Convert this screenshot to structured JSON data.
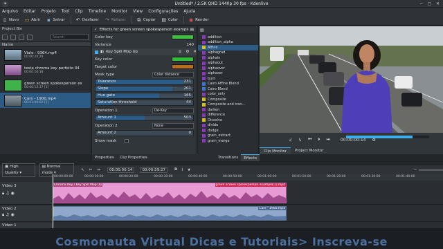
{
  "window": {
    "title": "Untitled* / 2.5K QHD 1440p 30 fps - Kdenlive"
  },
  "menu": [
    "Arquivo",
    "Editar",
    "Projeto",
    "Tool",
    "Clip",
    "Timeline",
    "Monitor",
    "View",
    "Configurações",
    "Ajuda"
  ],
  "toolbar": [
    {
      "icon": "new-icon",
      "label": "Novo"
    },
    {
      "icon": "open-icon",
      "label": "Abrir"
    },
    {
      "icon": "save-icon",
      "label": "Salvar"
    },
    {
      "icon": "undo-icon",
      "label": "Desfazer"
    },
    {
      "icon": "redo-icon",
      "label": "Refazer"
    },
    {
      "icon": "copy-icon",
      "label": "Copiar"
    },
    {
      "icon": "paste-icon",
      "label": "Colar"
    },
    {
      "icon": "render-icon",
      "label": "Render"
    }
  ],
  "bin": {
    "title": "Project Bin",
    "search_placeholder": "Search",
    "column": "Name",
    "clips": [
      {
        "name": "Viale - 9364.mp4",
        "meta": "00:00:20:29",
        "thumb": "#6f8fa8",
        "selected": false
      },
      {
        "name": "teste chroma key perfeito 04",
        "meta": "00:00:10:18",
        "thumb": "#b07ab8",
        "selected": false
      },
      {
        "name": "green screen spokesperson ex",
        "meta": "00:00:13:17  [1]",
        "thumb": "#3fb24a",
        "selected": false
      },
      {
        "name": "Cars - 1900.mp4",
        "meta": "00:01:00:02  [1]",
        "thumb": "#6d7a86",
        "selected": true
      }
    ]
  },
  "effects": {
    "header": "Effects for green screen spokesperson example[1]",
    "color_key_label": "Color key",
    "color_key_swatch": "#3fbf3f",
    "variance_label": "Variance",
    "variance_value": "140",
    "spill_title": "Key Spill Mop Up",
    "key_color_label": "Key color",
    "key_color_swatch": "#2fc03a",
    "target_color_label": "Target color",
    "target_color_swatch": "#b86d1d",
    "mask_type_label": "Mask type",
    "mask_type_value": "Color distance",
    "sliders": [
      {
        "label": "Tolerance",
        "value": "231",
        "fill": 0.9
      },
      {
        "label": "Slope",
        "value": "201",
        "fill": 0.79
      },
      {
        "label": "Hue gate",
        "value": "165",
        "fill": 0.65
      },
      {
        "label": "Saturation threshold",
        "value": "44",
        "fill": 0.17
      }
    ],
    "op1_label": "Operation 1",
    "op1_value": "De-Key",
    "amount1_label": "Amount 1",
    "amount1_value": "503",
    "op2_label": "Operation 2",
    "op2_value": "None",
    "amount2_label": "Amount 2",
    "amount2_value": "0",
    "show_mask_label": "Show mask"
  },
  "effect_list": [
    {
      "name": "addition",
      "color": "#8a3ab9"
    },
    {
      "name": "addition_alpha",
      "color": "#8a3ab9"
    },
    {
      "name": "Affine",
      "color": "#d0c020"
    },
    {
      "name": "alphagrad",
      "color": "#8a3ab9"
    },
    {
      "name": "alphain",
      "color": "#8a3ab9"
    },
    {
      "name": "alphaout",
      "color": "#8a3ab9"
    },
    {
      "name": "alphaover",
      "color": "#8a3ab9"
    },
    {
      "name": "alphaxor",
      "color": "#8a3ab9"
    },
    {
      "name": "burn",
      "color": "#8a3ab9"
    },
    {
      "name": "Cairo Affine Blend",
      "color": "#3d77d0"
    },
    {
      "name": "Cairo Blend",
      "color": "#3d77d0"
    },
    {
      "name": "color_only",
      "color": "#8a3ab9"
    },
    {
      "name": "Composite",
      "color": "#d0c020"
    },
    {
      "name": "Composite and tran...",
      "color": "#d0c020"
    },
    {
      "name": "darken",
      "color": "#8a3ab9"
    },
    {
      "name": "difference",
      "color": "#8a3ab9"
    },
    {
      "name": "Dissolve",
      "color": "#d0c020"
    },
    {
      "name": "divide",
      "color": "#8a3ab9"
    },
    {
      "name": "dodge",
      "color": "#8a3ab9"
    },
    {
      "name": "grain_extract",
      "color": "#8a3ab9"
    },
    {
      "name": "grain_merge",
      "color": "#8a3ab9"
    }
  ],
  "panel_tabs": [
    "Properties",
    "Clip Properties",
    "Transitions",
    "Effects",
    "Clip Monitor",
    "Project Monitor"
  ],
  "monitor": {
    "timecode": "00:00:00:14"
  },
  "timeline": {
    "quality": "High Quality",
    "mode": "Normal mode",
    "position": "00:00:00:14",
    "duration": "00:00:59:27",
    "ruler": [
      "00:00:00:00",
      "00:00:10:00",
      "00:00:20:00",
      "00:00:30:00",
      "00:00:40:00",
      "00:00:50:00",
      "00:01:00:00",
      "00:01:10:00",
      "00:01:20:00",
      "00:01:30:00",
      "00:01:40:00",
      "00:01:50:00"
    ],
    "tracks": [
      {
        "name": "Video 3",
        "clip_left": "Chroma Key / Key Spill Mop Up",
        "clip_right": "green screen spokesperson example[1].mp4"
      },
      {
        "name": "Video 2",
        "clip_right": "Cars - 1900.mp4"
      },
      {
        "name": "Video 1"
      }
    ]
  },
  "banner": {
    "text": "Cosmonauta Virtual Dicas e Tutoriais> Inscreva-se"
  }
}
